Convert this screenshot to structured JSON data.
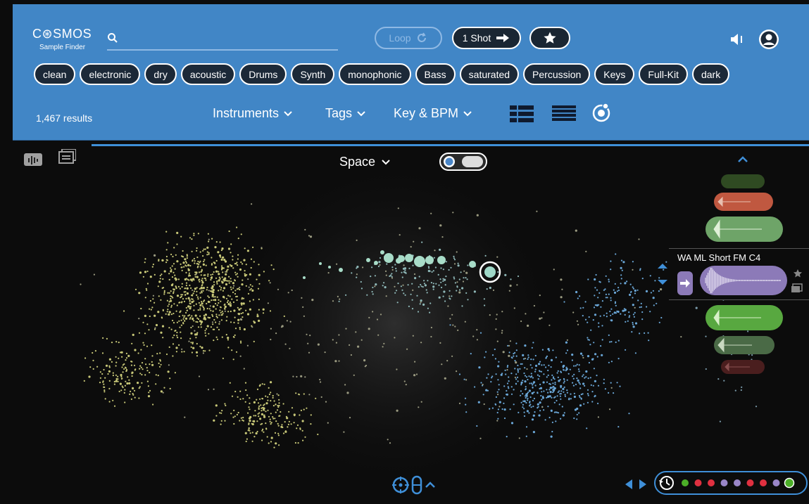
{
  "app": {
    "logo_main": "C⊛SMOS",
    "logo_sub": "Sample Finder"
  },
  "header": {
    "search_placeholder": "",
    "loop_label": "Loop",
    "oneshot_label": "1 Shot",
    "results": "1,467 results",
    "dropdowns": [
      "Instruments",
      "Tags",
      "Key & BPM"
    ]
  },
  "tags": [
    "clean",
    "electronic",
    "dry",
    "acoustic",
    "Drums",
    "Synth",
    "monophonic",
    "Bass",
    "saturated",
    "Percussion",
    "Keys",
    "Full-Kit",
    "dark"
  ],
  "space": {
    "view_label": "Space"
  },
  "selected_sample": {
    "name": "WA ML Short FM C4"
  },
  "colors": {
    "header_bg": "#4186c6",
    "accent_blue": "#3f8fd8",
    "dot_yellow": "#c8c878",
    "dot_blue": "#6aa6d6",
    "dot_teal": "#9fd8c8",
    "purple": "#8c7ab8",
    "green": "#58a840",
    "red": "#c05840",
    "history_dots": [
      "#4caf28",
      "#e03040",
      "#e03040",
      "#9a86c8",
      "#9a86c8",
      "#e03040",
      "#e03040",
      "#9a86c8",
      "#4caf28"
    ]
  },
  "icons": {
    "search": "search-icon",
    "loop": "loop-icon",
    "arrow": "arrow-right-icon",
    "star": "star-icon",
    "speaker": "speaker-icon",
    "user": "user-icon",
    "history": "history-icon"
  }
}
